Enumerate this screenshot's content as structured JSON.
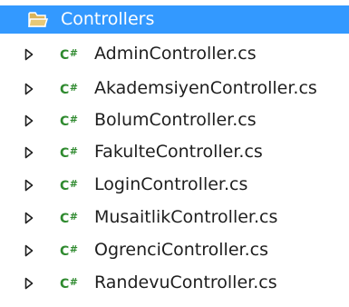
{
  "folder": {
    "name": "Controllers",
    "icon": "folder-open-icon"
  },
  "files": [
    {
      "name": "AdminController.cs",
      "icon": "csharp-file-icon",
      "icon_text": "C",
      "icon_sharp": "#"
    },
    {
      "name": "AkademsiyenController.cs",
      "icon": "csharp-file-icon",
      "icon_text": "C",
      "icon_sharp": "#"
    },
    {
      "name": "BolumController.cs",
      "icon": "csharp-file-icon",
      "icon_text": "C",
      "icon_sharp": "#"
    },
    {
      "name": "FakulteController.cs",
      "icon": "csharp-file-icon",
      "icon_text": "C",
      "icon_sharp": "#"
    },
    {
      "name": "LoginController.cs",
      "icon": "csharp-file-icon",
      "icon_text": "C",
      "icon_sharp": "#"
    },
    {
      "name": "MusaitlikController.cs",
      "icon": "csharp-file-icon",
      "icon_text": "C",
      "icon_sharp": "#"
    },
    {
      "name": "OgrenciController.cs",
      "icon": "csharp-file-icon",
      "icon_text": "C",
      "icon_sharp": "#"
    },
    {
      "name": "RandevuController.cs",
      "icon": "csharp-file-icon",
      "icon_text": "C",
      "icon_sharp": "#"
    }
  ],
  "colors": {
    "selection": "#3399ff",
    "csharp_icon": "#2f8a2f",
    "text": "#1e1e1e"
  }
}
